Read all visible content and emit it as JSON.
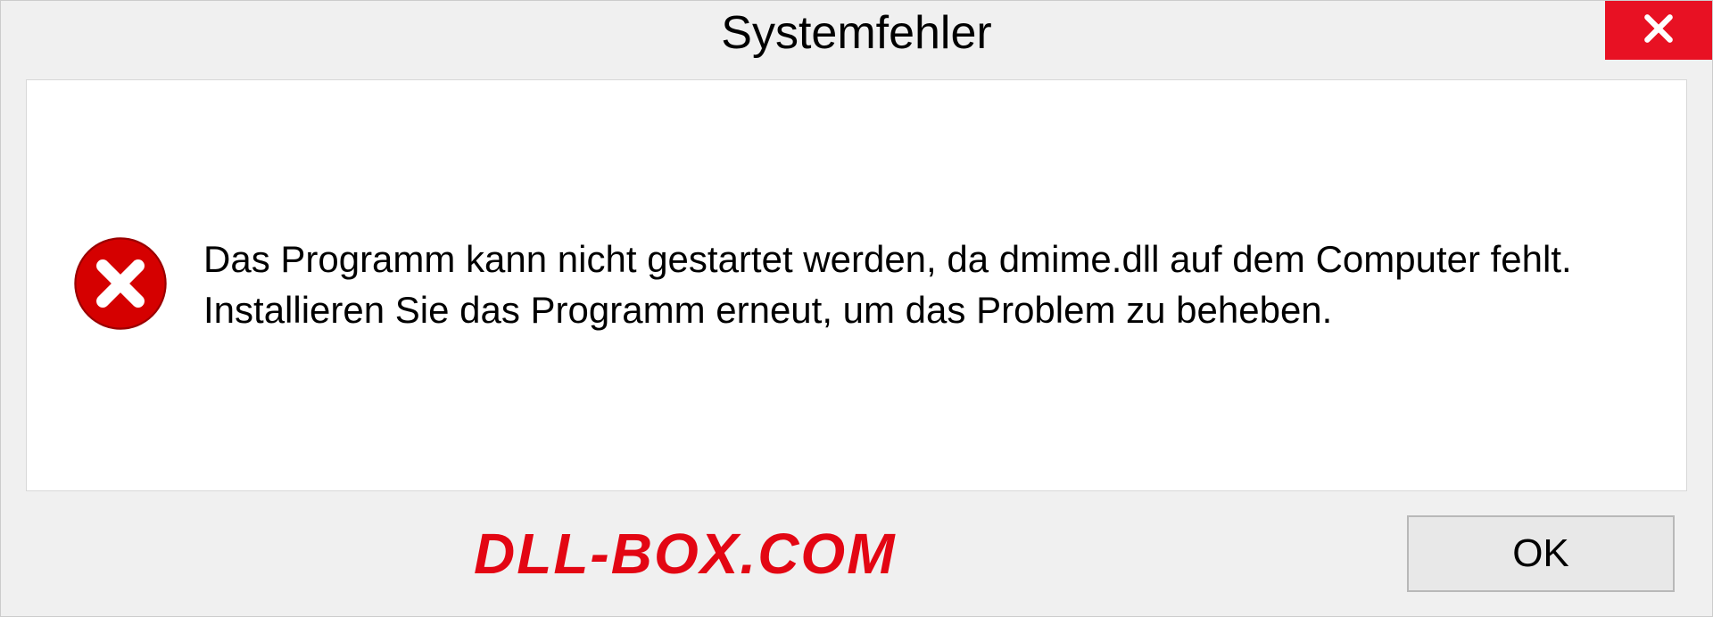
{
  "dialog": {
    "title": "Systemfehler",
    "message": "Das Programm kann nicht gestartet werden, da dmime.dll auf dem Computer fehlt. Installieren Sie das Programm erneut, um das Problem zu beheben.",
    "ok_label": "OK"
  },
  "watermark": "DLL-BOX.COM",
  "colors": {
    "close_bg": "#e81123",
    "error_icon": "#d50000",
    "watermark": "#e30613"
  }
}
